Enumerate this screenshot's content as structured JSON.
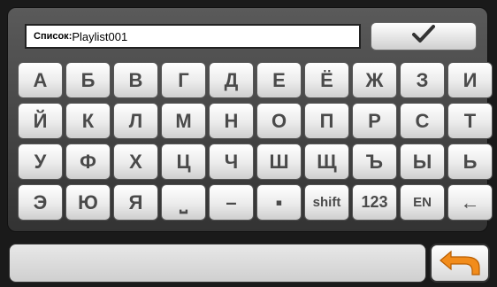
{
  "input": {
    "label": "Список:",
    "value": "Playlist001"
  },
  "confirm_icon": "checkmark-icon",
  "keyboard": {
    "rows": [
      [
        "А",
        "Б",
        "В",
        "Г",
        "Д",
        "Е",
        "Ё",
        "Ж",
        "З",
        "И"
      ],
      [
        "Й",
        "К",
        "Л",
        "М",
        "Н",
        "О",
        "П",
        "Р",
        "С",
        "Т"
      ],
      [
        "У",
        "Ф",
        "Х",
        "Ц",
        "Ч",
        "Ш",
        "Щ",
        "Ъ",
        "Ы",
        "Ь"
      ],
      [
        "Э",
        "Ю",
        "Я",
        "⎵",
        "–",
        "▪",
        "shift",
        "123",
        "EN",
        "←"
      ]
    ]
  },
  "back_icon": "back-arrow-icon",
  "colors": {
    "accent_back": "#f28c1b"
  }
}
